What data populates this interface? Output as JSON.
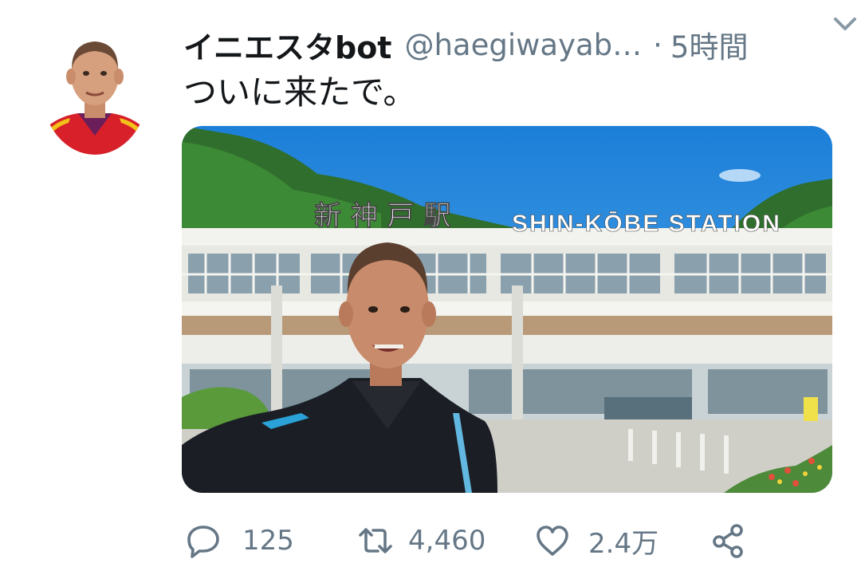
{
  "tweet": {
    "display_name": "イニエスタbot",
    "handle": "@haegiwayab…",
    "separator": "·",
    "time": "5時間",
    "text": "ついに来たで。",
    "avatar_icon": "avatar-photo",
    "menu_icon": "chevron-down-icon",
    "media": {
      "sign_japanese": "新 神 戸 駅",
      "sign_english": "SHIN-KŌBE  STATION"
    },
    "actions": {
      "reply": {
        "icon": "reply-icon",
        "count": "125"
      },
      "retweet": {
        "icon": "retweet-icon",
        "count": "4,460"
      },
      "like": {
        "icon": "heart-icon",
        "count": "2.4万"
      },
      "share": {
        "icon": "share-icon"
      }
    }
  },
  "colors": {
    "text_primary": "#14171a",
    "text_secondary": "#657786",
    "background": "#ffffff"
  }
}
